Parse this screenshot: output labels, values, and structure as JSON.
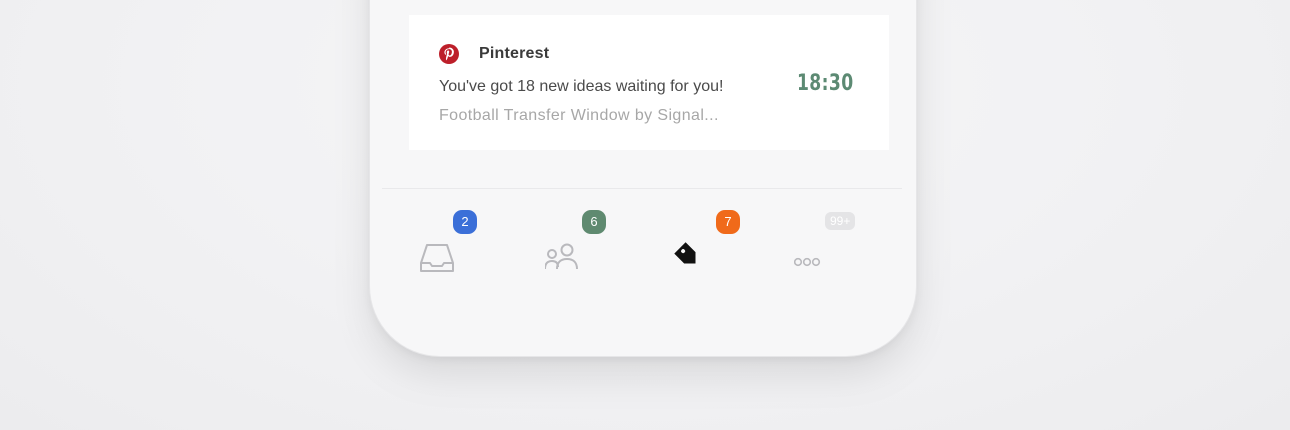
{
  "notification": {
    "app_name": "Pinterest",
    "app_icon": "pinterest-icon",
    "title": "You've got 18 new ideas waiting for you!",
    "subtitle": "Football Transfer Window by Signal...",
    "time": "18:30",
    "accent_color": "#bd1f2a",
    "time_color": "#5c8a73"
  },
  "tabbar": {
    "tabs": [
      {
        "name": "inbox",
        "icon": "inbox-tray-icon",
        "badge": "2",
        "badge_color": "#3b6fd8",
        "active": false
      },
      {
        "name": "people",
        "icon": "people-icon",
        "badge": "6",
        "badge_color": "#5f8a70",
        "active": false
      },
      {
        "name": "tags",
        "icon": "tag-icon",
        "badge": "7",
        "badge_color": "#f06a1a",
        "active": true
      },
      {
        "name": "more",
        "icon": "more-dots-icon",
        "badge": "99+",
        "badge_color": "#e4e4e6",
        "active": false
      }
    ]
  }
}
